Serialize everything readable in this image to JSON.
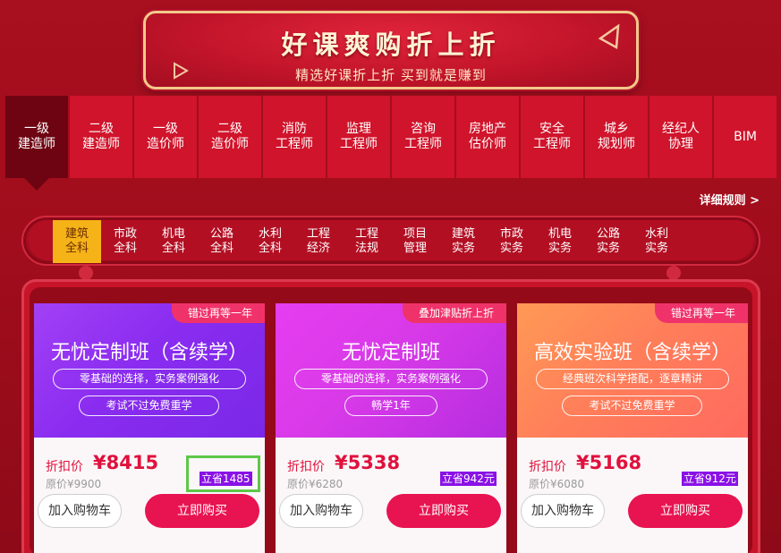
{
  "banner": {
    "title": "好课爽购折上折",
    "subtitle": "精选好课折上折 买到就是赚到"
  },
  "exam_tabs": [
    {
      "line1": "一级",
      "line2": "建造师",
      "active": true
    },
    {
      "line1": "二级",
      "line2": "建造师",
      "active": false
    },
    {
      "line1": "一级",
      "line2": "造价师",
      "active": false
    },
    {
      "line1": "二级",
      "line2": "造价师",
      "active": false
    },
    {
      "line1": "消防",
      "line2": "工程师",
      "active": false
    },
    {
      "line1": "监理",
      "line2": "工程师",
      "active": false
    },
    {
      "line1": "咨询",
      "line2": "工程师",
      "active": false
    },
    {
      "line1": "房地产",
      "line2": "估价师",
      "active": false
    },
    {
      "line1": "安全",
      "line2": "工程师",
      "active": false
    },
    {
      "line1": "城乡",
      "line2": "规划师",
      "active": false
    },
    {
      "line1": "经纪人",
      "line2": "协理",
      "active": false
    },
    {
      "line1": "BIM",
      "line2": "",
      "active": false
    }
  ],
  "rules_link": "详细规则 >",
  "subject_tabs": [
    {
      "line1": "建筑",
      "line2": "全科",
      "active": true
    },
    {
      "line1": "市政",
      "line2": "全科",
      "active": false
    },
    {
      "line1": "机电",
      "line2": "全科",
      "active": false
    },
    {
      "line1": "公路",
      "line2": "全科",
      "active": false
    },
    {
      "line1": "水利",
      "line2": "全科",
      "active": false
    },
    {
      "line1": "工程",
      "line2": "经济",
      "active": false
    },
    {
      "line1": "工程",
      "line2": "法规",
      "active": false
    },
    {
      "line1": "项目",
      "line2": "管理",
      "active": false
    },
    {
      "line1": "建筑",
      "line2": "实务",
      "active": false
    },
    {
      "line1": "市政",
      "line2": "实务",
      "active": false
    },
    {
      "line1": "机电",
      "line2": "实务",
      "active": false
    },
    {
      "line1": "公路",
      "line2": "实务",
      "active": false
    },
    {
      "line1": "水利",
      "line2": "实务",
      "active": false
    }
  ],
  "cards": [
    {
      "tag": "错过再等一年",
      "title": "无忧定制班（含续学）",
      "pill1": "零基础的选择，实务案例强化",
      "pill2": "考试不过免费重学",
      "price_label": "折扣价",
      "price": "¥8415",
      "original_price": "原价¥9900",
      "save": "立省1485",
      "cart_label": "加入购物车",
      "buy_label": "立即购买",
      "theme": "purple"
    },
    {
      "tag": "叠加津贴折上折",
      "title": "无忧定制班",
      "pill1": "零基础的选择，实务案例强化",
      "pill2": "畅学1年",
      "price_label": "折扣价",
      "price": "¥5338",
      "original_price": "原价¥6280",
      "save": "立省942元",
      "cart_label": "加入购物车",
      "buy_label": "立即购买",
      "theme": "pink"
    },
    {
      "tag": "错过再等一年",
      "title": "高效实验班（含续学）",
      "pill1": "经典班次科学搭配，逐章精讲",
      "pill2": "考试不过免费重学",
      "price_label": "折扣价",
      "price": "¥5168",
      "original_price": "原价¥6080",
      "save": "立省912元",
      "cart_label": "加入购物车",
      "buy_label": "立即购买",
      "theme": "orange"
    }
  ],
  "colors": {
    "accent_red": "#e0113d",
    "buy_button": "#e81351",
    "active_subject": "#f5b318",
    "save_badge": "#8a11e6",
    "highlight": "#5ec748"
  }
}
